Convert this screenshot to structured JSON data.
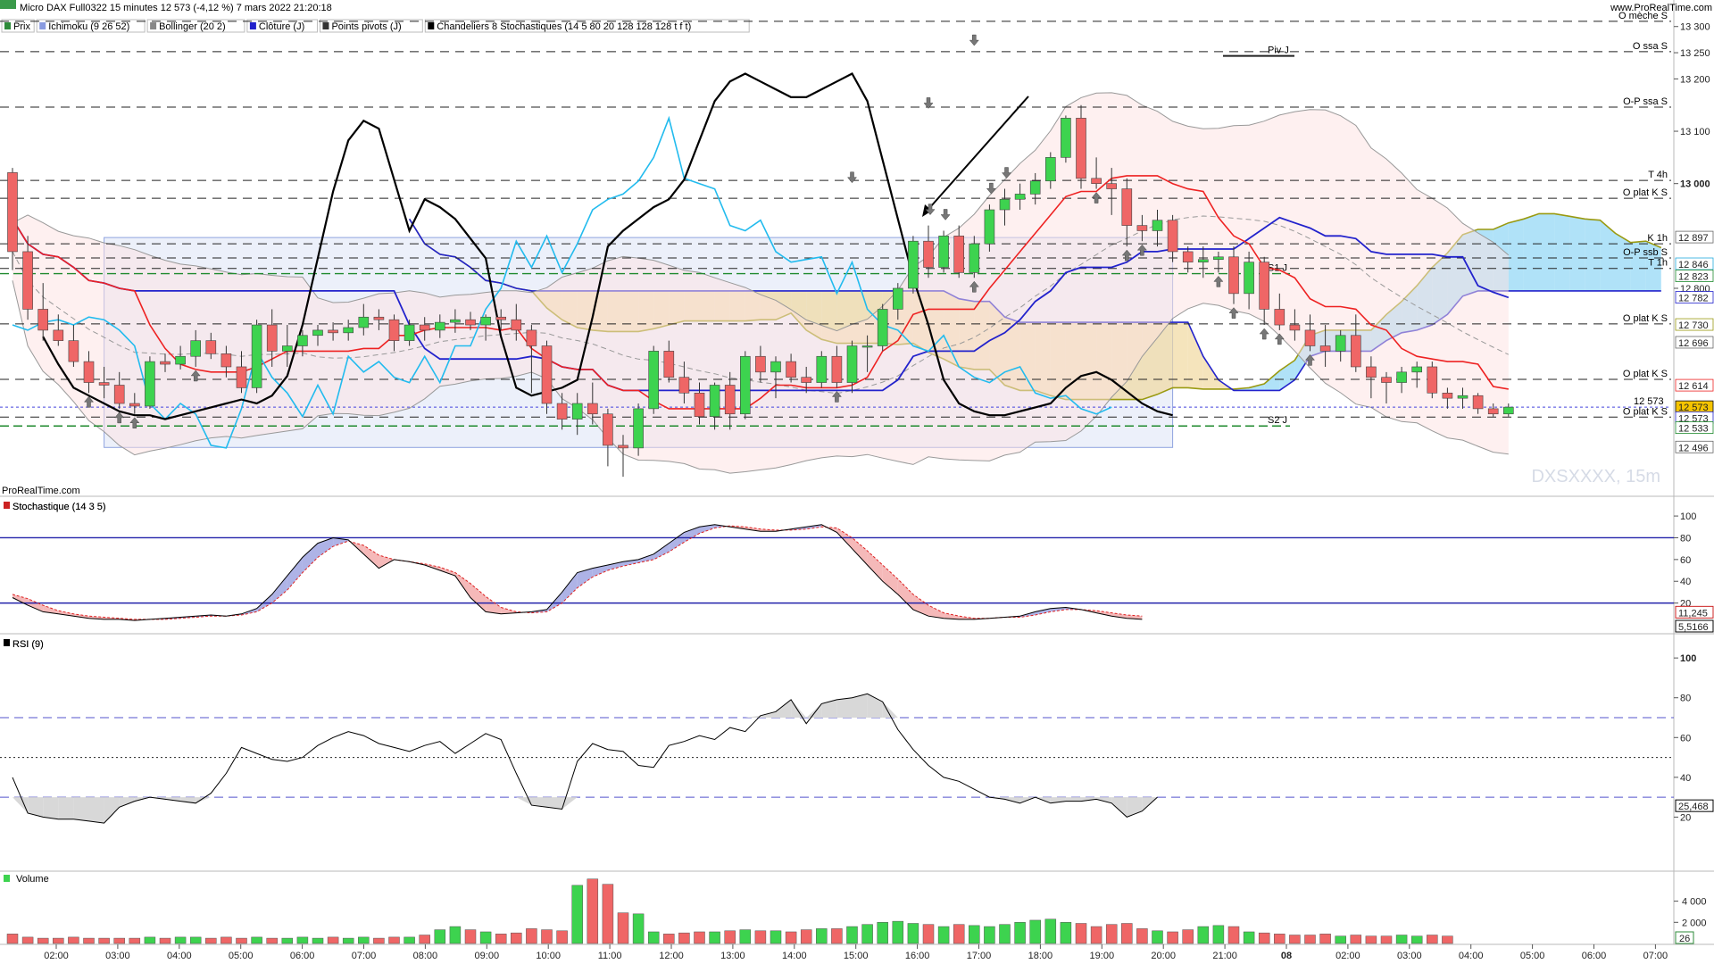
{
  "header": {
    "title": "Micro DAX Full0322 15 minutes 12 573 (-4,12 %) 7 mars 2022 21:20:18",
    "site": "www.ProRealTime.com",
    "indicators": [
      {
        "label": "Prix",
        "color": "#2e8b3a"
      },
      {
        "label": "Ichimoku (9 26 52)",
        "color": "#8a9be0"
      },
      {
        "label": "Bollinger (20 2)",
        "color": "#888888"
      },
      {
        "label": "Clôture (J)",
        "color": "#2222cc"
      },
      {
        "label": "Points pivots (J)",
        "color": "#333333"
      },
      {
        "label": "Chandeliers 8 Stochastiques (14 5 80 20 128 128 128 t f t)",
        "color": "#000000"
      }
    ]
  },
  "branding": {
    "prorealtime": "ProRealTime.com",
    "watermark": "DXSXXXX, 15m"
  },
  "colors": {
    "up": "#3dd34f",
    "down": "#ef6666",
    "kijun": "#2222cc",
    "tenkan": "#ee2222",
    "chikou": "#22bbee",
    "bollinger": "#999999",
    "stoch_k": "#000000",
    "stoch_d": "#dd2222"
  },
  "time_axis": {
    "labels": [
      "02:00",
      "03:00",
      "04:00",
      "05:00",
      "06:00",
      "07:00",
      "08:00",
      "09:00",
      "10:00",
      "11:00",
      "12:00",
      "13:00",
      "14:00",
      "15:00",
      "16:00",
      "17:00",
      "18:00",
      "19:00",
      "20:00",
      "21:00",
      "08",
      "02:00",
      "03:00",
      "04:00",
      "05:00",
      "06:00",
      "07:00"
    ]
  },
  "price_axis": {
    "ticks": [
      "13 300",
      "13 250",
      "13 200",
      "13 100",
      "13 000",
      "12 800"
    ]
  },
  "price_badges": [
    {
      "text": "12 897",
      "price": 12897,
      "color": "#666666",
      "bg": "#ffffff"
    },
    {
      "text": "12 846",
      "price": 12846,
      "color": "#22aadd",
      "bg": "#ffffff"
    },
    {
      "text": "12 823",
      "price": 12823,
      "color": "#1f8a2e",
      "bg": "#ffffff"
    },
    {
      "text": "12 782",
      "price": 12782,
      "color": "#2222cc",
      "bg": "#ffffff"
    },
    {
      "text": "12 730",
      "price": 12730,
      "color": "#9a9a11",
      "bg": "#ffffff"
    },
    {
      "text": "12 696",
      "price": 12696,
      "color": "#666666",
      "bg": "#ffffff"
    },
    {
      "text": "12 614",
      "price": 12614,
      "color": "#ee2222",
      "bg": "#ffffff"
    },
    {
      "text": "12 573",
      "price": 12573,
      "color": "#000000",
      "bg": "#f5c400"
    },
    {
      "text": "12 573",
      "price": 12552,
      "color": "#2222cc",
      "bg": "#ffffff"
    },
    {
      "text": "12 533",
      "price": 12533,
      "color": "#1f8a2e",
      "bg": "#ffffff"
    },
    {
      "text": "12 496",
      "price": 12496,
      "color": "#666666",
      "bg": "#ffffff"
    }
  ],
  "levels": [
    {
      "label": "O mèche S",
      "price": 13310,
      "style": "dash"
    },
    {
      "label": "O ssa S",
      "price": 13252,
      "style": "dash"
    },
    {
      "label": "Piv J",
      "price": 13244,
      "style": "solid",
      "label_side": "mid"
    },
    {
      "label": "O-P ssa S",
      "price": 13146,
      "style": "dash"
    },
    {
      "label": "T 4h",
      "price": 13006,
      "style": "dash"
    },
    {
      "label": "O plat K S",
      "price": 12972,
      "style": "dash"
    },
    {
      "label": "K 1h",
      "price": 12885,
      "style": "dash"
    },
    {
      "label": "O-P ssb S",
      "price": 12858,
      "style": "dash"
    },
    {
      "label": "T 1h",
      "price": 12838,
      "style": "dash"
    },
    {
      "label": "S1 J",
      "price": 12828,
      "style": "green",
      "label_side": "mid"
    },
    {
      "label": "O plat K S",
      "price": 12732,
      "style": "dash"
    },
    {
      "label": "O plat K S",
      "price": 12626,
      "style": "dash"
    },
    {
      "label": "12 573",
      "price": 12573,
      "style": "blue-dot",
      "label_side": "mid2"
    },
    {
      "label": "O plat K S",
      "price": 12554,
      "style": "dash"
    },
    {
      "label": "S2 J",
      "price": 12537,
      "style": "green",
      "label_side": "mid"
    }
  ],
  "chart_data": {
    "type": "candlestick",
    "interval": "15m",
    "ylim": [
      12430,
      13320
    ],
    "bars": [
      [
        13021,
        13030,
        12835,
        12870
      ],
      [
        12870,
        12900,
        12740,
        12760
      ],
      [
        12760,
        12810,
        12700,
        12720
      ],
      [
        12720,
        12750,
        12690,
        12700
      ],
      [
        12700,
        12730,
        12650,
        12660
      ],
      [
        12660,
        12680,
        12600,
        12620
      ],
      [
        12620,
        12650,
        12590,
        12615
      ],
      [
        12615,
        12640,
        12570,
        12580
      ],
      [
        12580,
        12600,
        12560,
        12575
      ],
      [
        12575,
        12670,
        12570,
        12660
      ],
      [
        12660,
        12675,
        12640,
        12655
      ],
      [
        12655,
        12690,
        12645,
        12670
      ],
      [
        12670,
        12720,
        12650,
        12700
      ],
      [
        12700,
        12715,
        12665,
        12675
      ],
      [
        12675,
        12690,
        12630,
        12650
      ],
      [
        12650,
        12680,
        12600,
        12610
      ],
      [
        12610,
        12740,
        12600,
        12730
      ],
      [
        12730,
        12760,
        12650,
        12680
      ],
      [
        12680,
        12730,
        12650,
        12690
      ],
      [
        12690,
        12720,
        12670,
        12710
      ],
      [
        12710,
        12730,
        12690,
        12720
      ],
      [
        12720,
        12735,
        12700,
        12715
      ],
      [
        12715,
        12740,
        12700,
        12725
      ],
      [
        12725,
        12770,
        12710,
        12745
      ],
      [
        12745,
        12760,
        12720,
        12740
      ],
      [
        12740,
        12750,
        12680,
        12700
      ],
      [
        12700,
        12740,
        12690,
        12730
      ],
      [
        12730,
        12745,
        12700,
        12720
      ],
      [
        12720,
        12750,
        12705,
        12735
      ],
      [
        12735,
        12760,
        12715,
        12740
      ],
      [
        12740,
        12755,
        12720,
        12730
      ],
      [
        12730,
        12750,
        12700,
        12745
      ],
      [
        12745,
        12760,
        12720,
        12740
      ],
      [
        12740,
        12770,
        12700,
        12720
      ],
      [
        12720,
        12730,
        12600,
        12690
      ],
      [
        12690,
        12700,
        12560,
        12580
      ],
      [
        12580,
        12600,
        12530,
        12550
      ],
      [
        12550,
        12600,
        12520,
        12580
      ],
      [
        12580,
        12620,
        12540,
        12560
      ],
      [
        12560,
        12570,
        12460,
        12500
      ],
      [
        12500,
        12520,
        12440,
        12495
      ],
      [
        12495,
        12580,
        12480,
        12570
      ],
      [
        12570,
        12690,
        12560,
        12680
      ],
      [
        12680,
        12700,
        12620,
        12630
      ],
      [
        12630,
        12660,
        12580,
        12600
      ],
      [
        12600,
        12620,
        12540,
        12555
      ],
      [
        12555,
        12620,
        12530,
        12615
      ],
      [
        12615,
        12640,
        12530,
        12560
      ],
      [
        12560,
        12680,
        12550,
        12670
      ],
      [
        12670,
        12690,
        12620,
        12640
      ],
      [
        12640,
        12670,
        12590,
        12660
      ],
      [
        12660,
        12675,
        12620,
        12630
      ],
      [
        12630,
        12650,
        12600,
        12620
      ],
      [
        12620,
        12680,
        12610,
        12670
      ],
      [
        12670,
        12690,
        12610,
        12620
      ],
      [
        12620,
        12700,
        12600,
        12690
      ],
      [
        12690,
        12710,
        12640,
        12690
      ],
      [
        12690,
        12770,
        12680,
        12760
      ],
      [
        12760,
        12810,
        12740,
        12800
      ],
      [
        12800,
        12900,
        12790,
        12890
      ],
      [
        12890,
        12920,
        12820,
        12840
      ],
      [
        12840,
        12910,
        12830,
        12900
      ],
      [
        12900,
        12920,
        12820,
        12830
      ],
      [
        12830,
        12900,
        12820,
        12885
      ],
      [
        12885,
        12960,
        12870,
        12950
      ],
      [
        12950,
        12990,
        12920,
        12970
      ],
      [
        12970,
        13000,
        12950,
        12980
      ],
      [
        12980,
        13020,
        12960,
        13005
      ],
      [
        13005,
        13060,
        12990,
        13050
      ],
      [
        13050,
        13130,
        13040,
        13125
      ],
      [
        13125,
        13150,
        12990,
        13010
      ],
      [
        13010,
        13050,
        12990,
        13000
      ],
      [
        13000,
        13030,
        12940,
        12990
      ],
      [
        12990,
        13010,
        12880,
        12920
      ],
      [
        12920,
        12940,
        12890,
        12910
      ],
      [
        12910,
        12950,
        12880,
        12930
      ],
      [
        12930,
        12940,
        12850,
        12870
      ],
      [
        12870,
        12880,
        12830,
        12850
      ],
      [
        12850,
        12880,
        12820,
        12855
      ],
      [
        12855,
        12870,
        12830,
        12860
      ],
      [
        12860,
        12880,
        12770,
        12790
      ],
      [
        12790,
        12870,
        12760,
        12850
      ],
      [
        12850,
        12860,
        12730,
        12760
      ],
      [
        12760,
        12790,
        12720,
        12730
      ],
      [
        12730,
        12760,
        12700,
        12720
      ],
      [
        12720,
        12750,
        12680,
        12690
      ],
      [
        12690,
        12730,
        12650,
        12680
      ],
      [
        12680,
        12720,
        12660,
        12710
      ],
      [
        12710,
        12750,
        12640,
        12650
      ],
      [
        12650,
        12670,
        12590,
        12630
      ],
      [
        12630,
        12640,
        12580,
        12620
      ],
      [
        12620,
        12650,
        12600,
        12640
      ],
      [
        12640,
        12660,
        12610,
        12650
      ],
      [
        12650,
        12660,
        12590,
        12600
      ],
      [
        12600,
        12610,
        12570,
        12590
      ],
      [
        12590,
        12610,
        12570,
        12595
      ],
      [
        12595,
        12600,
        12560,
        12570
      ],
      [
        12570,
        12580,
        12555,
        12560
      ],
      [
        12560,
        12580,
        12555,
        12573
      ]
    ],
    "volumes": [
      90,
      60,
      50,
      50,
      60,
      50,
      50,
      50,
      50,
      60,
      50,
      60,
      60,
      50,
      60,
      50,
      60,
      50,
      50,
      60,
      50,
      60,
      50,
      60,
      50,
      60,
      60,
      80,
      130,
      160,
      130,
      110,
      90,
      100,
      140,
      130,
      120,
      550,
      610,
      560,
      290,
      280,
      110,
      90,
      100,
      110,
      110,
      120,
      130,
      120,
      120,
      110,
      130,
      140,
      140,
      160,
      180,
      200,
      210,
      190,
      180,
      160,
      180,
      170,
      160,
      180,
      200,
      220,
      230,
      200,
      190,
      160,
      180,
      190,
      140,
      120,
      110,
      130,
      160,
      170,
      160,
      110,
      100,
      90,
      80,
      80,
      90,
      70,
      80,
      70,
      70,
      80,
      70,
      80,
      70
    ],
    "stochastic": {
      "title": "Stochastique (14 3 5)",
      "ylim": [
        0,
        105
      ],
      "levels": [
        80,
        20
      ],
      "ticks": [
        "100",
        "80",
        "60",
        "40",
        "20"
      ],
      "badge_k": "5,5166",
      "badge_d": "11,245",
      "k": [
        25,
        18,
        12,
        10,
        8,
        6,
        5,
        5,
        4,
        5,
        6,
        7,
        8,
        9,
        8,
        10,
        15,
        28,
        45,
        62,
        75,
        80,
        78,
        65,
        52,
        60,
        58,
        55,
        50,
        45,
        25,
        12,
        10,
        11,
        12,
        14,
        30,
        48,
        52,
        55,
        58,
        60,
        65,
        75,
        85,
        90,
        92,
        90,
        88,
        86,
        86,
        88,
        90,
        92,
        85,
        70,
        55,
        40,
        28,
        14,
        8,
        6,
        5,
        5,
        6,
        7,
        8,
        12,
        15,
        16,
        14,
        11,
        8,
        6,
        5
      ],
      "d": [
        28,
        24,
        18,
        13,
        10,
        8,
        7,
        6,
        5,
        5,
        5,
        6,
        7,
        8,
        8,
        9,
        12,
        20,
        32,
        48,
        62,
        72,
        77,
        73,
        64,
        60,
        58,
        56,
        53,
        48,
        38,
        26,
        16,
        12,
        11,
        12,
        20,
        34,
        44,
        50,
        54,
        57,
        60,
        67,
        76,
        84,
        89,
        91,
        90,
        88,
        87,
        87,
        88,
        90,
        89,
        80,
        68,
        55,
        42,
        28,
        18,
        11,
        8,
        6,
        6,
        7,
        7,
        9,
        12,
        14,
        14,
        13,
        11,
        9,
        8
      ]
    },
    "rsi": {
      "title": "RSI (9)",
      "ylim": [
        0,
        105
      ],
      "levels": [
        70,
        50,
        30
      ],
      "ticks": [
        "100",
        "80",
        "60",
        "40",
        "20"
      ],
      "bold_ticks": [
        "100",
        "50"
      ],
      "badge": "25,468",
      "values": [
        40,
        22,
        20,
        19,
        19,
        18,
        17,
        25,
        28,
        30,
        29,
        28,
        27,
        32,
        42,
        55,
        52,
        49,
        48,
        50,
        56,
        60,
        63,
        61,
        57,
        55,
        53,
        56,
        58,
        52,
        57,
        62,
        59,
        42,
        26,
        25,
        24,
        48,
        57,
        54,
        53,
        46,
        45,
        56,
        58,
        61,
        59,
        65,
        63,
        71,
        73,
        79,
        67,
        77,
        79,
        80,
        82,
        78,
        64,
        54,
        46,
        40,
        38,
        34,
        30,
        29,
        27,
        30,
        27,
        28,
        28,
        29,
        27,
        20,
        23,
        30
      ]
    }
  }
}
